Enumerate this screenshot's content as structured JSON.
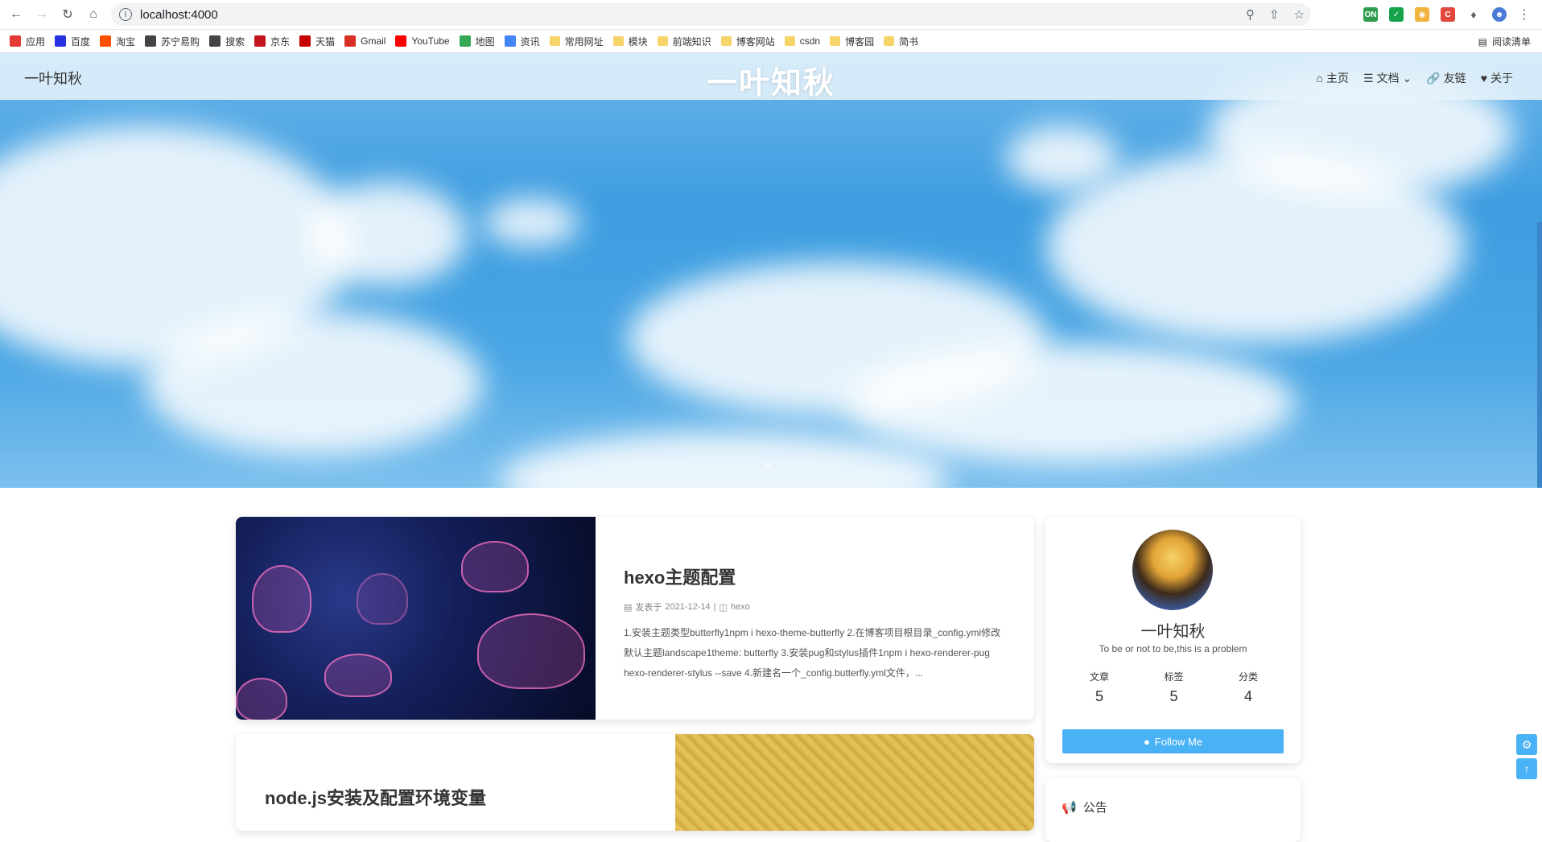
{
  "browser": {
    "url": "localhost:4000",
    "bookmarks": [
      {
        "label": "应用",
        "color": "#e53935"
      },
      {
        "label": "百度",
        "color": "#2932e1"
      },
      {
        "label": "淘宝",
        "color": "#ff5000"
      },
      {
        "label": "苏宁易购",
        "color": "#444444"
      },
      {
        "label": "搜索",
        "color": "#444444"
      },
      {
        "label": "京东",
        "color": "#c4161c"
      },
      {
        "label": "天猫",
        "color": "#c40000"
      },
      {
        "label": "Gmail",
        "color": "#d93025"
      },
      {
        "label": "YouTube",
        "color": "#ff0000"
      },
      {
        "label": "地图",
        "color": "#34a853"
      },
      {
        "label": "资讯",
        "color": "#4285f4"
      },
      {
        "label": "常用网址",
        "color": "#f6d46a"
      },
      {
        "label": "模块",
        "color": "#f6d46a"
      },
      {
        "label": "前端知识",
        "color": "#f6d46a"
      },
      {
        "label": "博客网站",
        "color": "#f6d46a"
      },
      {
        "label": "csdn",
        "color": "#f6d46a"
      },
      {
        "label": "博客园",
        "color": "#f6d46a"
      },
      {
        "label": "简书",
        "color": "#f6d46a"
      }
    ],
    "reading_list": "阅读清单"
  },
  "site": {
    "brand": "一叶知秋",
    "title": "一叶知秋",
    "menu": [
      "主页",
      "文档",
      "友链",
      "关于"
    ]
  },
  "posts": [
    {
      "title": "hexo主题配置",
      "meta_date_label": "发表于",
      "date": "2021-12-14",
      "category": "hexo",
      "excerpt": "1.安装主题类型butterfly1npm i hexo-theme-butterfly 2.在博客项目根目录_config.yml修改默认主题landscape1theme: butterfly 3.安装pug和stylus插件1npm i hexo-renderer-pug hexo-renderer-stylus --save 4.新建名一个_config.butterfly.yml文件，..."
    },
    {
      "title": "node.js安装及配置环境变量"
    }
  ],
  "profile": {
    "name": "一叶知秋",
    "motto": "To be or not to be,this is a problem",
    "stats": [
      {
        "label": "文章",
        "value": "5"
      },
      {
        "label": "标签",
        "value": "5"
      },
      {
        "label": "分类",
        "value": "4"
      }
    ],
    "follow": "Follow Me"
  },
  "announcement": {
    "title": "公告"
  },
  "colors": {
    "accent": "#49b1f5"
  }
}
